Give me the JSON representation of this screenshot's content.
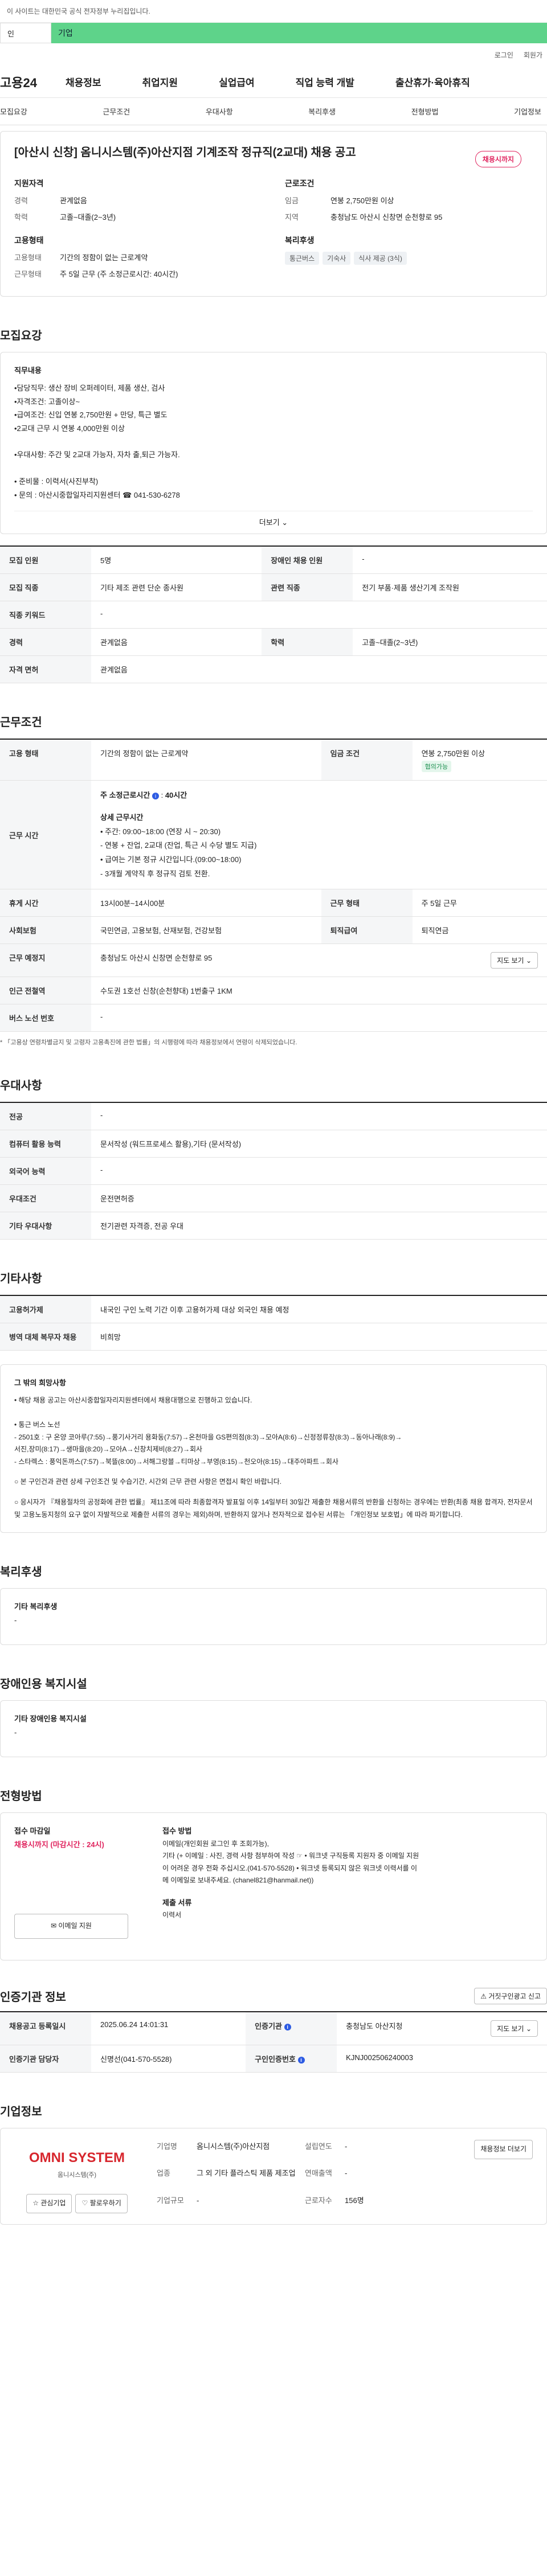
{
  "notice": "이 사이트는 대한민국 공식 전자정부 누리집입니다.",
  "sitetabs": [
    "인",
    "기업"
  ],
  "util": [
    "로그인",
    "회원가"
  ],
  "gnb": {
    "logo": "고용24",
    "menu": [
      "채용정보",
      "취업지원",
      "실업급여",
      "직업 능력 개발",
      "출산휴가·육아휴직"
    ]
  },
  "subnav": [
    "모집요강",
    "근무조건",
    "우대사항",
    "복리후생",
    "전형방법",
    "기업정보"
  ],
  "job": {
    "title": "[아산시 신창] 옴니시스템(주)아산지점 기계조작 정규직(2교대) 채용 공고",
    "badge": "채용시까지",
    "left_title": "지원자격",
    "career_k": "경력",
    "career_v": "관계없음",
    "edu_k": "학력",
    "edu_v": "고졸~대졸(2~3년)",
    "emp_title": "고용형태",
    "emptype_k": "고용형태",
    "emptype_v": "기간의 정함이 없는 근로계약",
    "worktype_k": "근무형태",
    "worktype_v": "주 5일 근무 (주 소정근로시간: 40시간)",
    "right_title": "근로조건",
    "pay_k": "임금",
    "pay_v": "연봉 2,750만원 이상",
    "loc_k": "지역",
    "loc_v": "충청남도 아산시 신창면 순천향로 95",
    "welfare_title": "복리후생",
    "welfare": [
      "통근버스",
      "기숙사",
      "식사 제공 (3식)"
    ]
  },
  "recruit": {
    "h": "모집요강",
    "duty_title": "직무내용",
    "duty_text": "•담당직무: 생산 장비 오퍼레이터, 제품 생산, 검사\n•자격조건: 고졸이상~\n•급여조건: 신입 연봉 2,750만원 + 만당, 특근 별도\n•2교대 근무 시 연봉 4,000만원 이상\n\n•우대사항: 주간 및 2교대 가능자, 자차 출,퇴근 가능자.\n\n• 준비물 : 이력서(사진부착)\n• 문의 : 아산시중합일자리지원센터 ☎ 041-530-6278",
    "more": "더보기",
    "rows": [
      [
        "모집 인원",
        "5명",
        "장애인 채용 인원",
        "-"
      ],
      [
        "모집 직종",
        "기타 제조 관련 단순 종사원",
        "관련 직종",
        "전기 부품·제품 생산기계 조작원"
      ],
      [
        "직종 키워드",
        "-",
        "",
        ""
      ],
      [
        "경력",
        "관계없음",
        "학력",
        "고졸~대졸(2~3년)"
      ],
      [
        "자격 면허",
        "관계없음",
        "",
        ""
      ]
    ]
  },
  "work": {
    "h": "근무조건",
    "emptype_k": "고용 형태",
    "emptype_v": "기간의 정함이 없는 근로계약",
    "wage_k": "임금 조건",
    "wage_v": "연봉 2,750만원 이상",
    "wage_tag": "협의가능",
    "time_k": "근무 시간",
    "time_head": "주 소정근로시간",
    "time_hours": "40시간",
    "time_detail_h": "상세 근무시간",
    "time_detail": "• 주간: 09:00~18:00 (연장 시 ~ 20:30)\n- 연봉 + 잔업, 2교대 (잔업, 특근 시 수당 별도 지급)\n• 급여는 기본 정규 시간입니다.(09:00~18:00)\n- 3개월 계약직 후 정규직 검토 전환.",
    "rest_k": "휴게 시간",
    "rest_v": "13시00분~14시00분",
    "worktype_k": "근무 형태",
    "worktype_v": "주 5일 근무",
    "ins_k": "사회보험",
    "ins_v": "국민연금, 고용보험, 산재보험, 건강보험",
    "sev_k": "퇴직급여",
    "sev_v": "퇴직연금",
    "place_k": "근무 예정지",
    "place_v": "충청남도 아산시 신창면 순천향로 95",
    "map_btn": "지도 보기",
    "sub_k": "인근 전철역",
    "sub_v": "수도권 1호선 신창(순천향대) 1번출구 1KM",
    "bus_k": "버스 노선 번호",
    "bus_v": "-",
    "note": "* 「고용상 연령차별금지 및 고령자 고용촉진에 관한 법률」의 시행령에 따라 채용정보에서 연령이 삭제되었습니다."
  },
  "pref": {
    "h": "우대사항",
    "rows": [
      [
        "전공",
        "-"
      ],
      [
        "컴퓨터 활용 능력",
        "문서작성 (워드프로세스 활용),기타 (문서작성)"
      ],
      [
        "외국어 능력",
        "-"
      ],
      [
        "우대조건",
        "운전면허증"
      ],
      [
        "기타 우대사항",
        "전기관련 자격증, 전공 우대"
      ]
    ]
  },
  "etc": {
    "h": "기타사항",
    "rows": [
      [
        "고용허가제",
        "내국인 구인 노력 기간 이후 고용허가제 대상 외국인 채용 예정"
      ],
      [
        "병역 대체 복무자 채용",
        "비희망"
      ]
    ],
    "box_h": "그 밖의 희망사항",
    "box_text": "• 해당 채용 공고는 아산시중합일자리지원센터에서 채용대행으로 진행하고 있습니다.\n\n• 통근 버스 노선\n- 2501호 : 구 온양 코아루(7:55)→풍기사거리 용화동(7:57)→온천마을 GS편의점(8:3)→모아A(8:6)→신정정류장(8:3)→동아나래(8:9)→\n서진,장미(8:17)→생마을(8:20)→모아A→신창치제비(8:27)→회사\n- 스타렉스 : 풍익돈까스(7:57)→북뜰(8:00)→서해그랑블→티마상→부영(8:15)→천오아(8:15)→대주아파트→회사",
    "circle1": "본 구인건과 관련 상세 구인조건 및 수습기간, 시간외 근무 관련 사항은 면접시 확인 바랍니다.",
    "circle2": "응시자가 『채용절차의 공정화에 관한 법률』 제11조에 따라 최종합격자 발표일 이후 14일부터 30일간 제출한 채용서류의 반환을 신청하는 경우에는 반환(최종 채용 합격자, 전자문서 및 고용노동지청의 요구 없이 자발적으로 제출한 서류의 경우는 제외)하며, 반환하지 않거나 전자적으로 접수된 서류는 「개인정보 보호법」에 따라 파기합니다."
  },
  "welfare": {
    "h": "복리후생",
    "sub": "기타 복리후생",
    "val": "-"
  },
  "disab": {
    "h": "장애인용 복지시설",
    "sub": "기타 장애인용 복지시설",
    "val": "-"
  },
  "apply": {
    "h": "전형방법",
    "deadline_h": "접수 마감일",
    "deadline_v": "채용시까지 (마감시간 : 24시)",
    "method_h": "접수 방법",
    "method_v": "이메일(개인회원 로그인 후 조회가능),\n기타 (+ 이메일 : 사진, 경력 사항 첨부하여 작성 ☞ • 워크넷 구직등록 지원자 중 이메일 지원\n이 어려운 경우 전화 주십시오.(041-570-5528) • 워크넷 등록되지 않은 워크넷 이력서를 이\n메 이메일로 보내주세요. (chanel821@hanmail.net))",
    "docs_h": "제출 서류",
    "docs_v": "이력서",
    "email_btn": "이메일 지원"
  },
  "cert": {
    "h": "인증기관 정보",
    "btn": "거짓구인광고 신고",
    "rows": [
      [
        "채용공고 등록일시",
        "2025.06.24 14:01:31",
        "인증기관",
        "충청남도 아산지청"
      ],
      [
        "인증기관 담당자",
        "신명선(041-570-5528)",
        "구인인증번호",
        "KJNJ002506240003"
      ]
    ],
    "map_btn": "지도 보기"
  },
  "company": {
    "h": "기업정보",
    "logo": "OMNI SYSTEM",
    "logo_kr": "옴니시스템(주)",
    "fav": "관심기업",
    "follow": "팔로우하기",
    "btn": "채용정보 더보기",
    "rows": [
      [
        "기업명",
        "옴니시스템(주)아산지점",
        "업종",
        "그 외 기타 플라스틱 제품 제조업",
        "기업규모",
        "-"
      ],
      [
        "설립연도",
        "-",
        "연매출액",
        "-",
        "근로자수",
        "156명"
      ]
    ]
  }
}
